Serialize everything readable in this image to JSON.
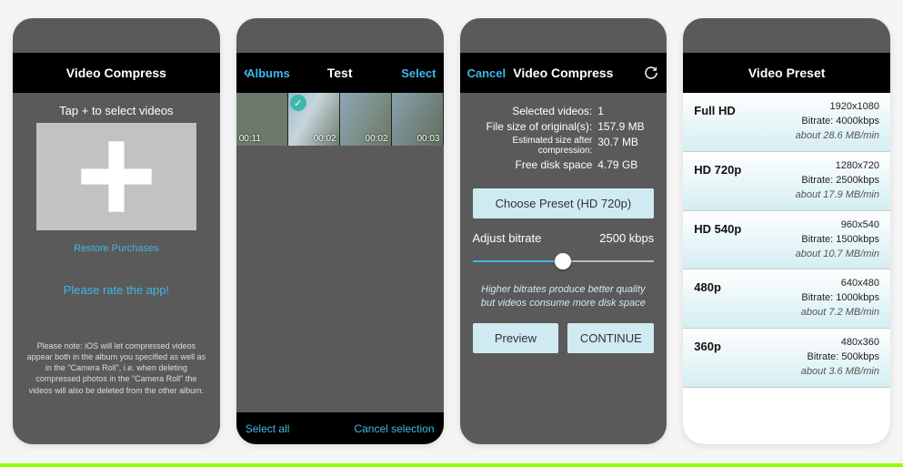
{
  "s1": {
    "title": "Video Compress",
    "tap": "Tap + to select videos",
    "restore": "Restore Purchases",
    "rate": "Please rate the app!",
    "note": "Please note: iOS will let compressed videos appear both in the album you specified as well as in the \"Camera Roll\", i.e. when deleting compressed photos in the \"Camera Roll\" the videos will also be deleted from the other album."
  },
  "s2": {
    "back": "Albums",
    "title": "Test",
    "select": "Select",
    "thumbs": [
      {
        "dur": "00:11"
      },
      {
        "dur": "00:02",
        "checked": true
      },
      {
        "dur": "00:02"
      },
      {
        "dur": "00:03"
      }
    ],
    "selectAll": "Select all",
    "cancelSel": "Cancel selection"
  },
  "s3": {
    "cancel": "Cancel",
    "title": "Video Compress",
    "stats": {
      "selLabel": "Selected videos:",
      "selVal": "1",
      "origLabel": "File size of original(s):",
      "origVal": "157.9 MB",
      "estLabel": "Estimated size after compression:",
      "estVal": "30.7 MB",
      "freeLabel": "Free disk space",
      "freeVal": "4.79 GB"
    },
    "choosePreset": "Choose Preset (HD 720p)",
    "adjustLabel": "Adjust bitrate",
    "adjustVal": "2500 kbps",
    "hint": "Higher bitrates produce better quality but videos consume more disk space",
    "preview": "Preview",
    "cont": "CONTINUE"
  },
  "s4": {
    "title": "Video Preset",
    "presets": [
      {
        "name": "Full HD",
        "res": "1920x1080",
        "bitrate": "Bitrate: 4000kbps",
        "est": "about 28.6 MB/min"
      },
      {
        "name": "HD 720p",
        "res": "1280x720",
        "bitrate": "Bitrate: 2500kbps",
        "est": "about 17.9 MB/min"
      },
      {
        "name": "HD 540p",
        "res": "960x540",
        "bitrate": "Bitrate: 1500kbps",
        "est": "about 10.7 MB/min"
      },
      {
        "name": "480p",
        "res": "640x480",
        "bitrate": "Bitrate: 1000kbps",
        "est": "about 7.2 MB/min"
      },
      {
        "name": "360p",
        "res": "480x360",
        "bitrate": "Bitrate: 500kbps",
        "est": "about 3.6 MB/min"
      }
    ]
  }
}
